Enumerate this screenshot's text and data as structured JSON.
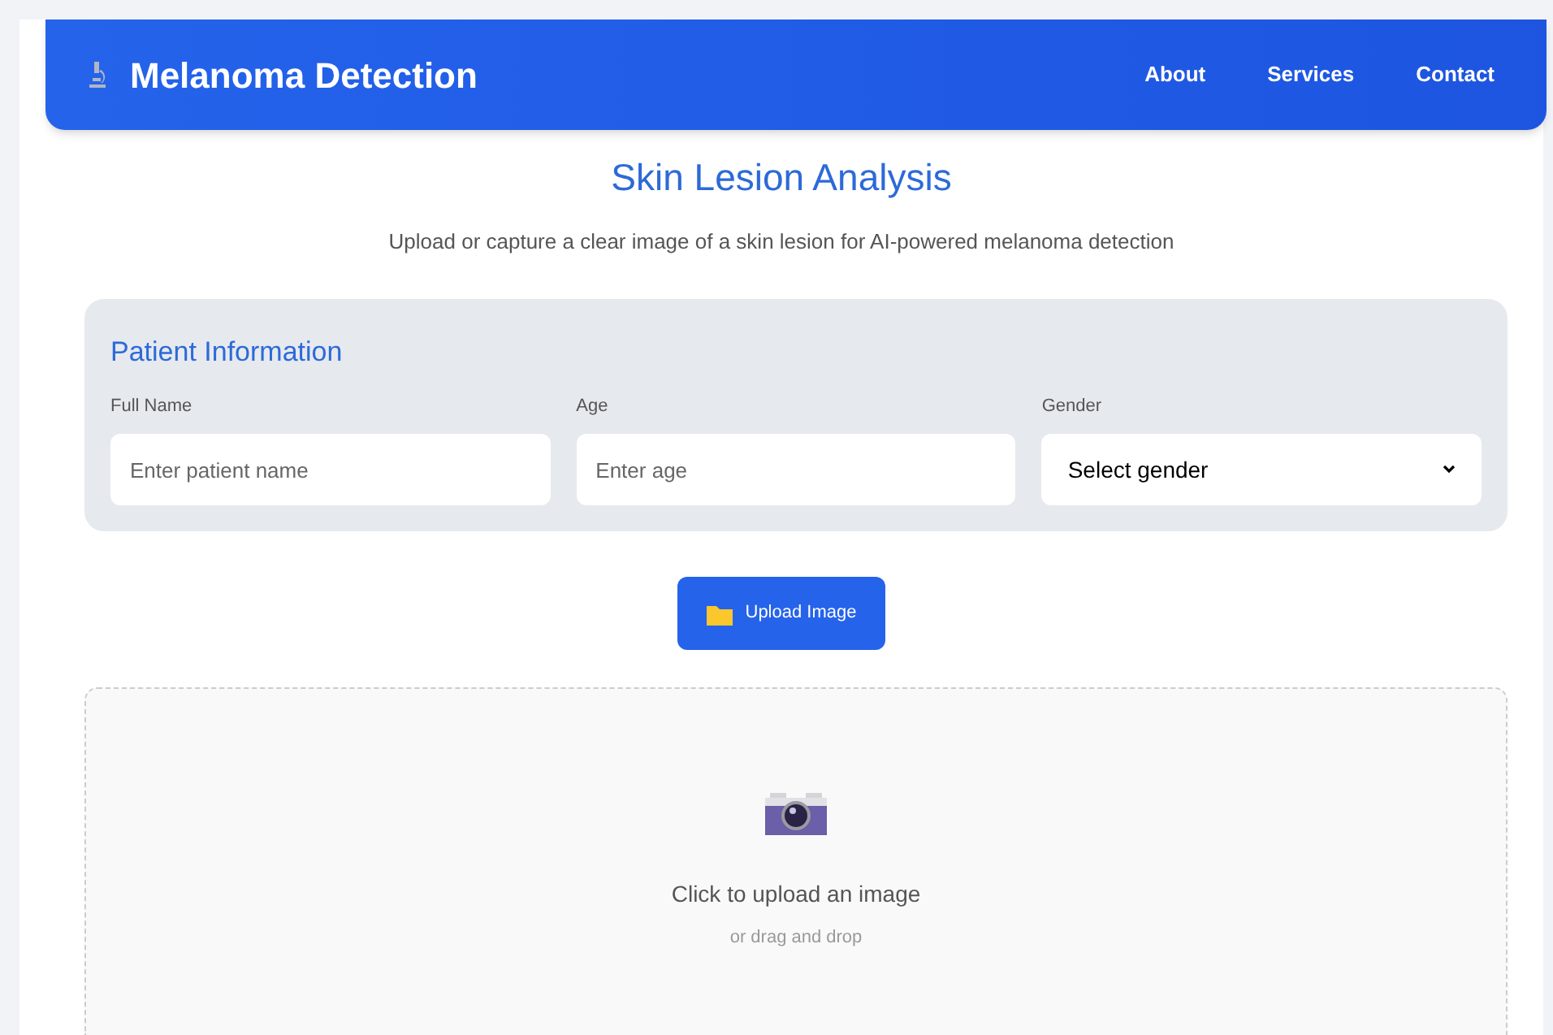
{
  "header": {
    "title": "Melanoma Detection",
    "nav": [
      "About",
      "Services",
      "Contact"
    ]
  },
  "heading": "Skin Lesion Analysis",
  "subtitle": "Upload or capture a clear image of a skin lesion for AI-powered melanoma detection",
  "patient_form": {
    "title": "Patient Information",
    "fields": [
      {
        "kind": "input",
        "label": "Full Name",
        "placeholder": "Enter patient name"
      },
      {
        "kind": "input",
        "label": "Age",
        "placeholder": "Enter age"
      },
      {
        "kind": "select",
        "label": "Gender",
        "value": "Select gender"
      }
    ]
  },
  "upload_button": "Upload Image",
  "dropzone": {
    "title": "Click to upload an image",
    "hint": "or drag and drop"
  }
}
